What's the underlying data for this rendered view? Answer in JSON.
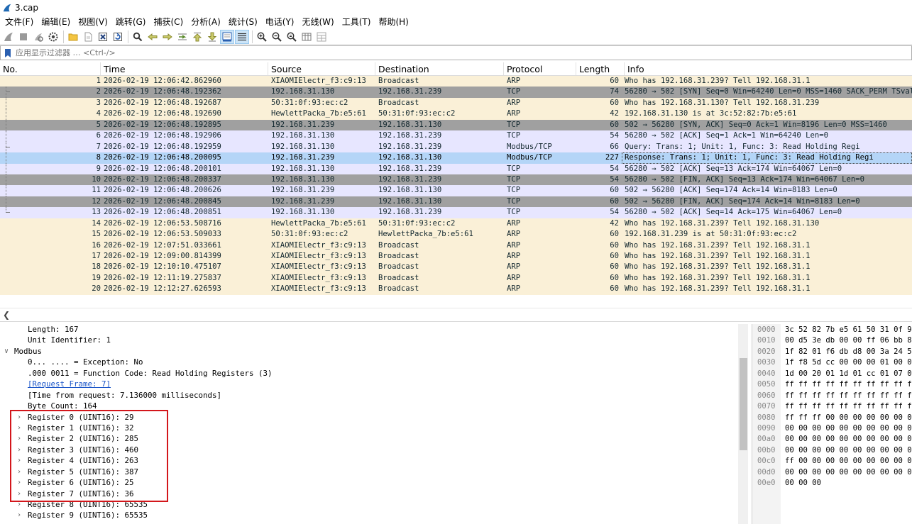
{
  "window": {
    "title": "3.cap"
  },
  "menu": [
    "文件(F)",
    "编辑(E)",
    "视图(V)",
    "跳转(G)",
    "捕获(C)",
    "分析(A)",
    "统计(S)",
    "电话(Y)",
    "无线(W)",
    "工具(T)",
    "帮助(H)"
  ],
  "filter": {
    "placeholder": "应用显示过滤器 … <Ctrl-/>",
    "value": ""
  },
  "columns": [
    "No.",
    "Time",
    "Source",
    "Destination",
    "Protocol",
    "Length",
    "Info"
  ],
  "packets": [
    {
      "no": "1",
      "time": "2026-02-19 12:06:42.862960",
      "src": "XIAOMIElectr_f3:c9:13",
      "dst": "Broadcast",
      "proto": "ARP",
      "len": "60",
      "info": "Who has 192.168.31.239? Tell 192.168.31.1",
      "style": "arp"
    },
    {
      "no": "2",
      "time": "2026-02-19 12:06:48.192362",
      "src": "192.168.31.130",
      "dst": "192.168.31.239",
      "proto": "TCP",
      "len": "74",
      "info": "56280 → 502 [SYN] Seq=0 Win=64240 Len=0 MSS=1460 SACK_PERM TSval",
      "style": "fin"
    },
    {
      "no": "3",
      "time": "2026-02-19 12:06:48.192687",
      "src": "50:31:0f:93:ec:c2",
      "dst": "Broadcast",
      "proto": "ARP",
      "len": "60",
      "info": "Who has 192.168.31.130? Tell 192.168.31.239",
      "style": "arp"
    },
    {
      "no": "4",
      "time": "2026-02-19 12:06:48.192690",
      "src": "HewlettPacka_7b:e5:61",
      "dst": "50:31:0f:93:ec:c2",
      "proto": "ARP",
      "len": "42",
      "info": "192.168.31.130 is at 3c:52:82:7b:e5:61",
      "style": "arp"
    },
    {
      "no": "5",
      "time": "2026-02-19 12:06:48.192895",
      "src": "192.168.31.239",
      "dst": "192.168.31.130",
      "proto": "TCP",
      "len": "60",
      "info": "502 → 56280 [SYN, ACK] Seq=0 Ack=1 Win=8196 Len=0 MSS=1460",
      "style": "fin"
    },
    {
      "no": "6",
      "time": "2026-02-19 12:06:48.192906",
      "src": "192.168.31.130",
      "dst": "192.168.31.239",
      "proto": "TCP",
      "len": "54",
      "info": "56280 → 502 [ACK] Seq=1 Ack=1 Win=64240 Len=0",
      "style": "tcp"
    },
    {
      "no": "7",
      "time": "2026-02-19 12:06:48.192959",
      "src": "192.168.31.130",
      "dst": "192.168.31.239",
      "proto": "Modbus/TCP",
      "len": "66",
      "info": "  Query: Trans:     1; Unit:   1, Func:   3: Read Holding Regi",
      "style": "tcp"
    },
    {
      "no": "8",
      "time": "2026-02-19 12:06:48.200095",
      "src": "192.168.31.239",
      "dst": "192.168.31.130",
      "proto": "Modbus/TCP",
      "len": "227",
      "info": "Response: Trans:     1; Unit:   1, Func:   3: Read Holding Regi",
      "style": "sel"
    },
    {
      "no": "9",
      "time": "2026-02-19 12:06:48.200101",
      "src": "192.168.31.130",
      "dst": "192.168.31.239",
      "proto": "TCP",
      "len": "54",
      "info": "56280 → 502 [ACK] Seq=13 Ack=174 Win=64067 Len=0",
      "style": "tcp"
    },
    {
      "no": "10",
      "time": "2026-02-19 12:06:48.200337",
      "src": "192.168.31.130",
      "dst": "192.168.31.239",
      "proto": "TCP",
      "len": "54",
      "info": "56280 → 502 [FIN, ACK] Seq=13 Ack=174 Win=64067 Len=0",
      "style": "fin"
    },
    {
      "no": "11",
      "time": "2026-02-19 12:06:48.200626",
      "src": "192.168.31.239",
      "dst": "192.168.31.130",
      "proto": "TCP",
      "len": "60",
      "info": "502 → 56280 [ACK] Seq=174 Ack=14 Win=8183 Len=0",
      "style": "tcp"
    },
    {
      "no": "12",
      "time": "2026-02-19 12:06:48.200845",
      "src": "192.168.31.239",
      "dst": "192.168.31.130",
      "proto": "TCP",
      "len": "60",
      "info": "502 → 56280 [FIN, ACK] Seq=174 Ack=14 Win=8183 Len=0",
      "style": "fin"
    },
    {
      "no": "13",
      "time": "2026-02-19 12:06:48.200851",
      "src": "192.168.31.130",
      "dst": "192.168.31.239",
      "proto": "TCP",
      "len": "54",
      "info": "56280 → 502 [ACK] Seq=14 Ack=175 Win=64067 Len=0",
      "style": "tcp"
    },
    {
      "no": "14",
      "time": "2026-02-19 12:06:53.508716",
      "src": "HewlettPacka_7b:e5:61",
      "dst": "50:31:0f:93:ec:c2",
      "proto": "ARP",
      "len": "42",
      "info": "Who has 192.168.31.239? Tell 192.168.31.130",
      "style": "arp"
    },
    {
      "no": "15",
      "time": "2026-02-19 12:06:53.509033",
      "src": "50:31:0f:93:ec:c2",
      "dst": "HewlettPacka_7b:e5:61",
      "proto": "ARP",
      "len": "60",
      "info": "192.168.31.239 is at 50:31:0f:93:ec:c2",
      "style": "arp"
    },
    {
      "no": "16",
      "time": "2026-02-19 12:07:51.033661",
      "src": "XIAOMIElectr_f3:c9:13",
      "dst": "Broadcast",
      "proto": "ARP",
      "len": "60",
      "info": "Who has 192.168.31.239? Tell 192.168.31.1",
      "style": "arp"
    },
    {
      "no": "17",
      "time": "2026-02-19 12:09:00.814399",
      "src": "XIAOMIElectr_f3:c9:13",
      "dst": "Broadcast",
      "proto": "ARP",
      "len": "60",
      "info": "Who has 192.168.31.239? Tell 192.168.31.1",
      "style": "arp"
    },
    {
      "no": "18",
      "time": "2026-02-19 12:10:10.475107",
      "src": "XIAOMIElectr_f3:c9:13",
      "dst": "Broadcast",
      "proto": "ARP",
      "len": "60",
      "info": "Who has 192.168.31.239? Tell 192.168.31.1",
      "style": "arp"
    },
    {
      "no": "19",
      "time": "2026-02-19 12:11:19.275837",
      "src": "XIAOMIElectr_f3:c9:13",
      "dst": "Broadcast",
      "proto": "ARP",
      "len": "60",
      "info": "Who has 192.168.31.239? Tell 192.168.31.1",
      "style": "arp"
    },
    {
      "no": "20",
      "time": "2026-02-19 12:12:27.626593",
      "src": "XIAOMIElectr_f3:c9:13",
      "dst": "Broadcast",
      "proto": "ARP",
      "len": "60",
      "info": "Who has 192.168.31.239? Tell 192.168.31.1",
      "style": "arp"
    }
  ],
  "details": [
    {
      "text": "Length: 167",
      "indent": 2,
      "expander": "none"
    },
    {
      "text": "Unit Identifier: 1",
      "indent": 2,
      "expander": "none"
    },
    {
      "text": "Modbus",
      "indent": 1,
      "expander": "expanded"
    },
    {
      "text": "0... .... = Exception: No",
      "indent": 2,
      "expander": "none"
    },
    {
      "text": ".000 0011 = Function Code: Read Holding Registers (3)",
      "indent": 2,
      "expander": "none"
    },
    {
      "text": "[Request Frame: 7]",
      "indent": 2,
      "expander": "none",
      "link": true
    },
    {
      "text": "[Time from request: 7.136000 milliseconds]",
      "indent": 2,
      "expander": "none"
    },
    {
      "text": "Byte Count: 164",
      "indent": 2,
      "expander": "none"
    },
    {
      "text": "Register 0 (UINT16): 29",
      "indent": 2,
      "expander": "collapsed"
    },
    {
      "text": "Register 1 (UINT16): 32",
      "indent": 2,
      "expander": "collapsed"
    },
    {
      "text": "Register 2 (UINT16): 285",
      "indent": 2,
      "expander": "collapsed"
    },
    {
      "text": "Register 3 (UINT16): 460",
      "indent": 2,
      "expander": "collapsed"
    },
    {
      "text": "Register 4 (UINT16): 263",
      "indent": 2,
      "expander": "collapsed"
    },
    {
      "text": "Register 5 (UINT16): 387",
      "indent": 2,
      "expander": "collapsed"
    },
    {
      "text": "Register 6 (UINT16): 25",
      "indent": 2,
      "expander": "collapsed"
    },
    {
      "text": "Register 7 (UINT16): 36",
      "indent": 2,
      "expander": "collapsed"
    },
    {
      "text": "Register 8 (UINT16): 65535",
      "indent": 2,
      "expander": "collapsed"
    },
    {
      "text": "Register 9 (UINT16): 65535",
      "indent": 2,
      "expander": "collapsed"
    }
  ],
  "bytes": [
    {
      "offset": "0000",
      "hex": "3c 52 82 7b e5 61 50 31  0f 9"
    },
    {
      "offset": "0010",
      "hex": "00 d5 3e db 00 00 ff 06  bb 8"
    },
    {
      "offset": "0020",
      "hex": "1f 82 01 f6 db d8 00 3a  24 5"
    },
    {
      "offset": "0030",
      "hex": "1f f8 5d cc 00 00 00 01  00 0"
    },
    {
      "offset": "0040",
      "hex": "1d 00 20 01 1d 01 cc 01  07 0"
    },
    {
      "offset": "0050",
      "hex": "ff ff ff ff ff ff ff ff  ff f"
    },
    {
      "offset": "0060",
      "hex": "ff ff ff ff ff ff ff ff  ff f"
    },
    {
      "offset": "0070",
      "hex": "ff ff ff ff ff ff ff ff  ff f"
    },
    {
      "offset": "0080",
      "hex": "ff ff ff 00 00 00 00 00  00 0"
    },
    {
      "offset": "0090",
      "hex": "00 00 00 00 00 00 00 00  00 0"
    },
    {
      "offset": "00a0",
      "hex": "00 00 00 00 00 00 00 00  00 0"
    },
    {
      "offset": "00b0",
      "hex": "00 00 00 00 00 00 00 00  00 0"
    },
    {
      "offset": "00c0",
      "hex": "ff 00 00 00 00 00 00 00  00 0"
    },
    {
      "offset": "00d0",
      "hex": "00 00 00 00 00 00 00 00  00 0"
    },
    {
      "offset": "00e0",
      "hex": "00 00 00"
    }
  ],
  "colors": {
    "arp_row": "#faf0d7",
    "tcp_row": "#e7e6ff",
    "fin_row": "#a0a0a0",
    "selected_row": "#b4d5f7",
    "highlight_box": "#d3161b"
  }
}
